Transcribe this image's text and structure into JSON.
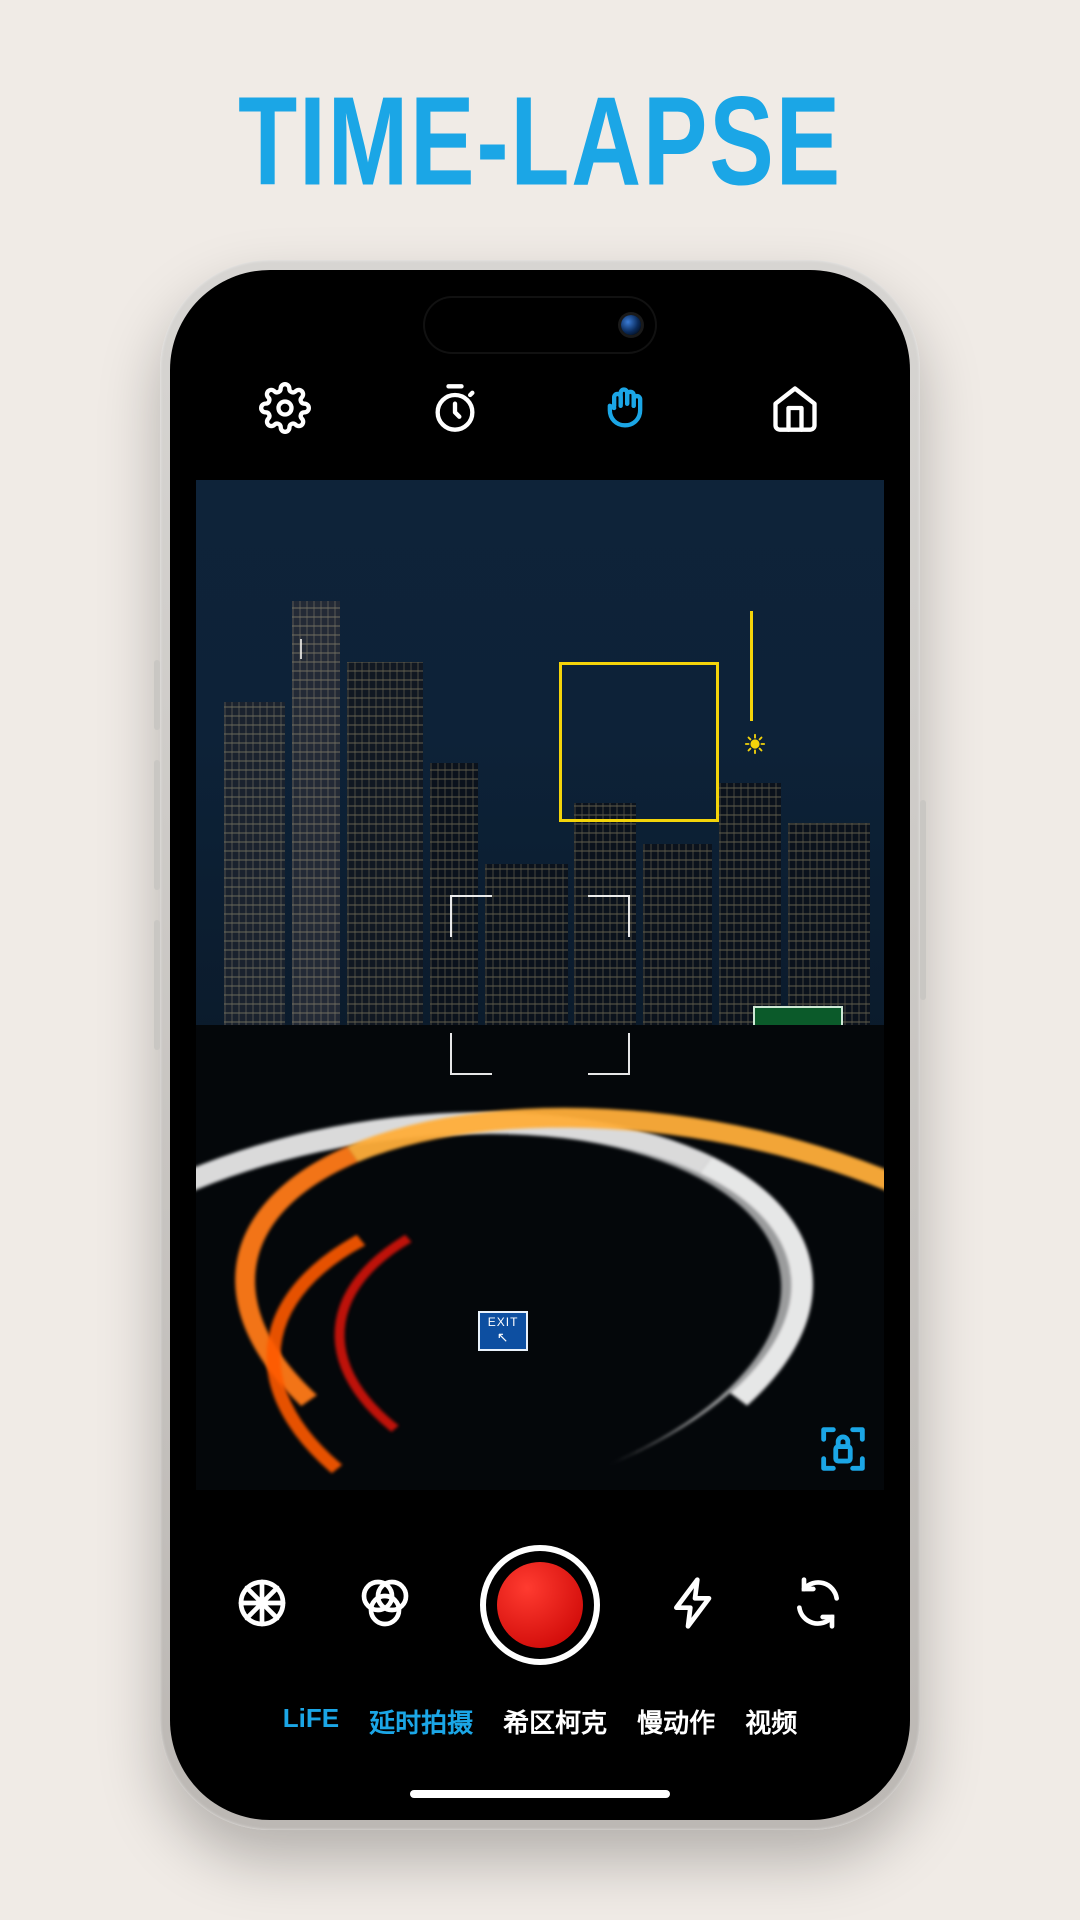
{
  "promo": {
    "title": "TIME-LAPSE"
  },
  "colors": {
    "accent": "#1ba6e6",
    "focus": "#f4d40a",
    "record": "#ff3b30"
  },
  "topbar": {
    "settings_icon": "settings",
    "timer_icon": "timer",
    "gesture_icon": "hand",
    "gesture_active": true,
    "home_icon": "home"
  },
  "viewfinder": {
    "exit_sign_label": "EXIT",
    "exit_sign_arrow": "↖"
  },
  "controls": {
    "gallery_icon": "gallery-wheel",
    "filters_icon": "filters",
    "shutter_icon": "record",
    "flash_icon": "flash",
    "switch_icon": "switch-camera"
  },
  "modes": {
    "items": [
      {
        "label": "LiFE",
        "accent": true
      },
      {
        "label": "延时拍摄",
        "accent": true
      },
      {
        "label": "希区柯克",
        "accent": false
      },
      {
        "label": "慢动作",
        "accent": false
      },
      {
        "label": "视频",
        "accent": false
      }
    ]
  }
}
